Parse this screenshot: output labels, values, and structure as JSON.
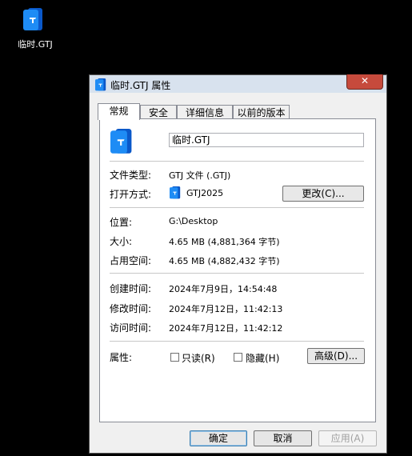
{
  "desktop": {
    "icon_label": "临时.GTJ"
  },
  "dialog": {
    "title": "临时.GTJ 属性",
    "close_symbol": "✕",
    "tabs": [
      "常规",
      "安全",
      "详细信息",
      "以前的版本"
    ],
    "file_name": "临时.GTJ",
    "file_type_label": "文件类型:",
    "file_type_value": "GTJ 文件 (.GTJ)",
    "open_with_label": "打开方式:",
    "open_with_value": "GTJ2025",
    "change_button": "更改(C)...",
    "location_label": "位置:",
    "location_value": "G:\\Desktop",
    "size_label": "大小:",
    "size_value": "4.65 MB (4,881,364 字节)",
    "disk_size_label": "占用空间:",
    "disk_size_value": "4.65 MB (4,882,432 字节)",
    "created_label": "创建时间:",
    "created_value": "2024年7月9日，14:54:48",
    "modified_label": "修改时间:",
    "modified_value": "2024年7月12日，11:42:13",
    "accessed_label": "访问时间:",
    "accessed_value": "2024年7月12日，11:42:12",
    "attributes_label": "属性:",
    "readonly_label": "只读(R)",
    "readonly_checked": false,
    "hidden_label": "隐藏(H)",
    "hidden_checked": false,
    "advanced_button": "高级(D)...",
    "ok_button": "确定",
    "cancel_button": "取消",
    "apply_button": "应用(A)"
  },
  "colors": {
    "icon_front": "#1e8cf5",
    "icon_back": "#0a58c9",
    "close": "#c64a3c"
  }
}
